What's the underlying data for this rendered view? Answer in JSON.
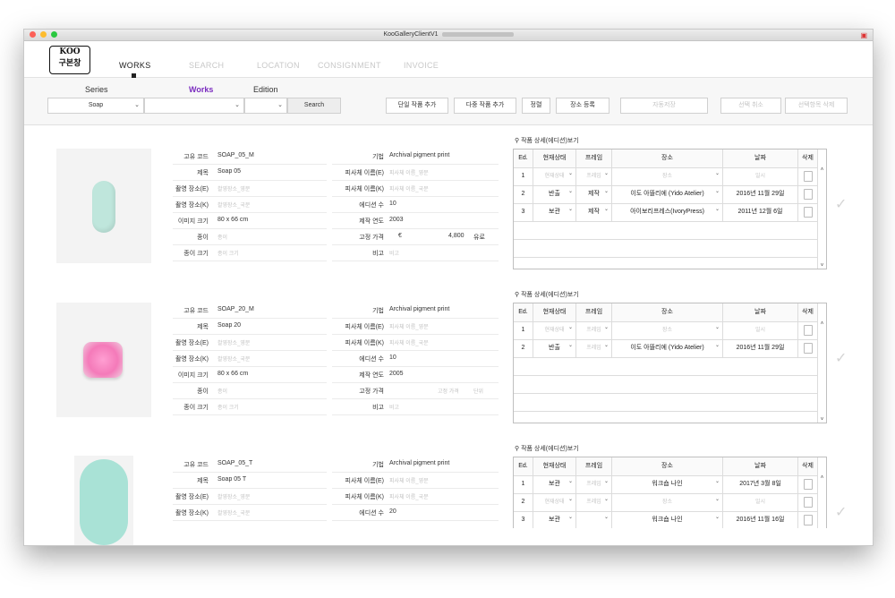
{
  "window": {
    "title": "KooGalleryClientV1"
  },
  "logo": {
    "line1": "KOO",
    "line2": "구본창"
  },
  "nav": {
    "tabs": [
      "WORKS",
      "SEARCH",
      "LOCATION",
      "CONSIGNMENT",
      "INVOICE"
    ],
    "active": "WORKS"
  },
  "filters": {
    "labels": {
      "series": "Series",
      "works": "Works",
      "edition": "Edition"
    },
    "series_value": "Soap",
    "works_value": "",
    "edition_value": "",
    "search_label": "Search"
  },
  "toolbar": {
    "add_single": "단일 작품 추가",
    "add_multi": "다중 작품 추가",
    "sort": "정렬",
    "register_location": "장소 등록",
    "autosave": "자동저장",
    "cancel_select": "선택 취소",
    "delete_select": "선택항목 삭제"
  },
  "labels": {
    "code": "고유 코드",
    "title": "제목",
    "shot_loc_e": "촬영 장소(E)",
    "shot_loc_k": "촬영 장소(K)",
    "img_size": "이미지 크기",
    "paper": "종이",
    "paper_size": "종이 크기",
    "technique": "기법",
    "subject_e": "피사체 이름(E)",
    "subject_k": "피사체 이름(K)",
    "edition_count": "에디션 수",
    "year": "제작 연도",
    "fixed_price": "고정 가격",
    "note": "비고"
  },
  "edition_panel": {
    "toggle": "작품 상세(에디션)보기",
    "headers": [
      "Ed.",
      "현재상태",
      "프레임",
      "장소",
      "날짜",
      "삭제"
    ]
  },
  "works": [
    {
      "code": "SOAP_05_M",
      "title": "Soap 05",
      "shot_loc_e": "촬영장소_영문",
      "shot_loc_k": "촬영장소_국문",
      "img_size": "80 x 66 cm",
      "paper": "종이",
      "paper_size": "종이 크기",
      "technique": "Archival pigment print",
      "subject_e": "피사체 이름_영문",
      "subject_k": "피사체 이름_국문",
      "edition_count": "10",
      "year": "2003",
      "price_currency": "€",
      "price_value": "4,800",
      "price_unit": "유로",
      "note": "비고",
      "editions": [
        {
          "ed": "1",
          "status": "현재상태",
          "frame": "프레임",
          "place": "장소",
          "date": "일시",
          "placeholder": true
        },
        {
          "ed": "2",
          "status": "반출",
          "frame": "제작",
          "place": "이도 아뜰리에 (Yido Atelier)",
          "date": "2016년 11월 29일",
          "placeholder": false
        },
        {
          "ed": "3",
          "status": "보관",
          "frame": "제작",
          "place": "아이보리프레스(IvoryPress)",
          "date": "2011년 12월 6일",
          "placeholder": false
        }
      ]
    },
    {
      "code": "SOAP_20_M",
      "title": "Soap 20",
      "shot_loc_e": "촬영장소_영문",
      "shot_loc_k": "촬영장소_국문",
      "img_size": "80 x 66 cm",
      "paper": "종이",
      "paper_size": "종이 크기",
      "technique": "Archival pigment print",
      "subject_e": "피사체 이름_영문",
      "subject_k": "피사체 이름_국문",
      "edition_count": "10",
      "year": "2005",
      "price_currency": "",
      "price_value": "고정 가격",
      "price_unit": "단위",
      "note": "비고",
      "editions": [
        {
          "ed": "1",
          "status": "현재상태",
          "frame": "프레임",
          "place": "장소",
          "date": "일시",
          "placeholder": true
        },
        {
          "ed": "2",
          "status": "반출",
          "frame": "프레임",
          "place": "이도 아뜰리에 (Yido Atelier)",
          "date": "2016년 11월 29일",
          "placeholder": false
        }
      ]
    },
    {
      "code": "SOAP_05_T",
      "title": "Soap 05 T",
      "shot_loc_e": "촬영장소_영문",
      "shot_loc_k": "촬영장소_국문",
      "technique": "Archival pigment print",
      "subject_e": "피사체 이름_영문",
      "subject_k": "피사체 이름_국문",
      "edition_count": "20",
      "editions": [
        {
          "ed": "1",
          "status": "보관",
          "frame": "프레임",
          "place": "워크숍 나인",
          "date": "2017년 3월 8일",
          "placeholder": false
        },
        {
          "ed": "2",
          "status": "현재상태",
          "frame": "프레임",
          "place": "장소",
          "date": "일시",
          "placeholder": true
        },
        {
          "ed": "3",
          "status": "보관",
          "frame": "",
          "place": "워크숍 나인",
          "date": "2016년 11월 16일",
          "placeholder": false
        }
      ]
    }
  ],
  "colors": {
    "accent": "#7a2bbf",
    "soap1": "#bfe6dc",
    "soap2": "#f58bc4",
    "soap3": "#a9e2d6"
  }
}
